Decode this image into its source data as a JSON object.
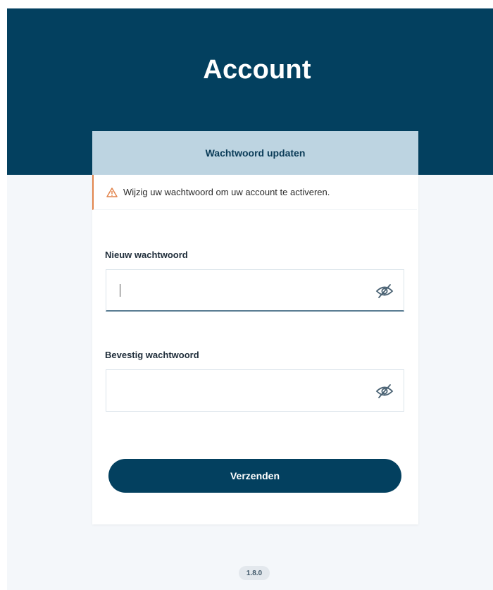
{
  "header": {
    "title": "Account"
  },
  "card": {
    "heading": "Wachtwoord updaten",
    "alert": {
      "icon": "warning-icon",
      "text": "Wijzig uw wachtwoord om uw account te activeren.",
      "accent": "#e2844c"
    },
    "fields": [
      {
        "label": "Nieuw wachtwoord",
        "value": "",
        "placeholder": ""
      },
      {
        "label": "Bevestig wachtwoord",
        "value": "",
        "placeholder": ""
      }
    ],
    "submit_label": "Verzenden"
  },
  "footer": {
    "version": "1.8.0"
  },
  "colors": {
    "brand": "#03405f",
    "card_header": "#bdd4e1",
    "background": "#f4f7fa"
  }
}
